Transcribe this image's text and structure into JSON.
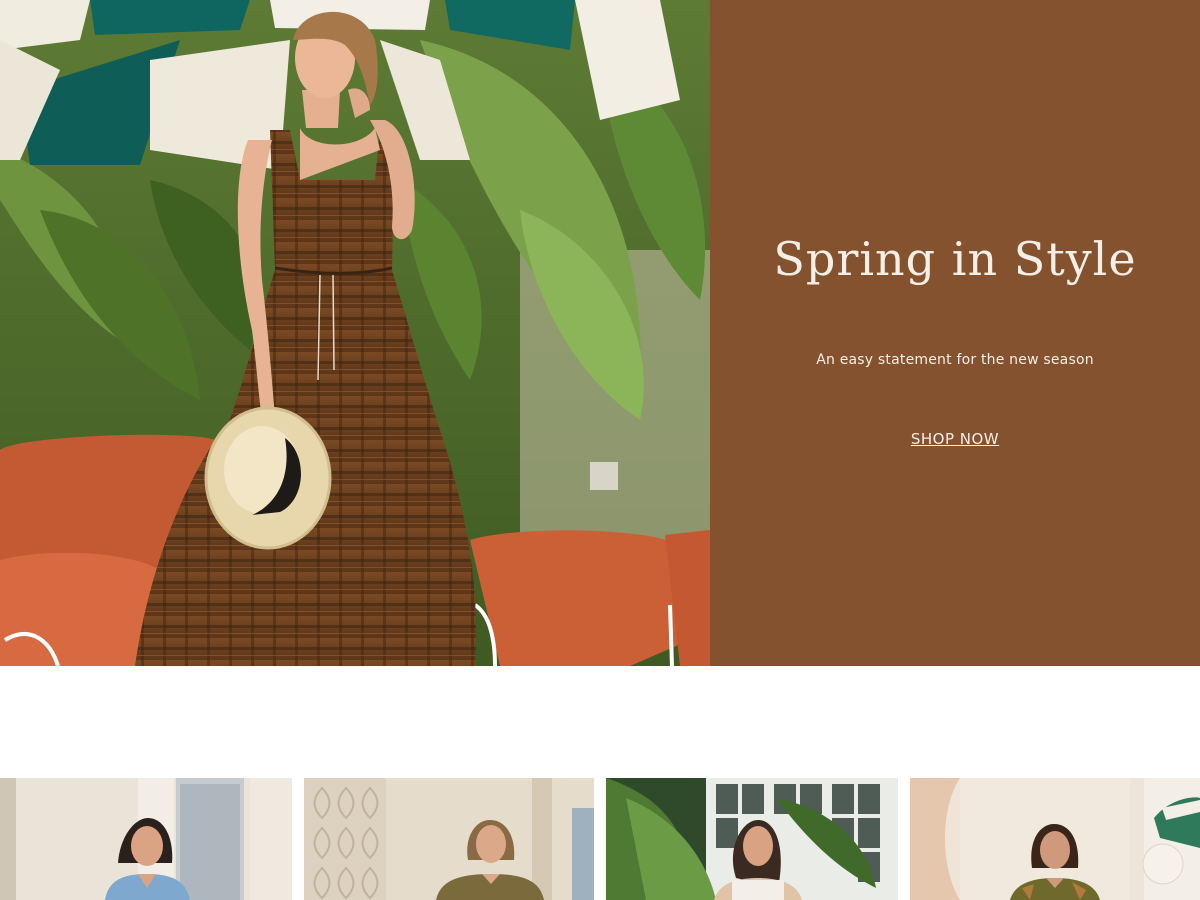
{
  "hero": {
    "title": "Spring in Style",
    "subtitle": "An easy statement for the new season",
    "cta_label": "SHOP NOW",
    "panel_color": "#85522f",
    "image_subject": "woman in brown plaid tiered maxi dress holding straw hat under striped umbrellas"
  },
  "products": [
    {
      "image_subject": "woman in denim top"
    },
    {
      "image_subject": "woman in olive shirt"
    },
    {
      "image_subject": "woman among palm leaves"
    },
    {
      "image_subject": "woman in patterned top"
    }
  ]
}
